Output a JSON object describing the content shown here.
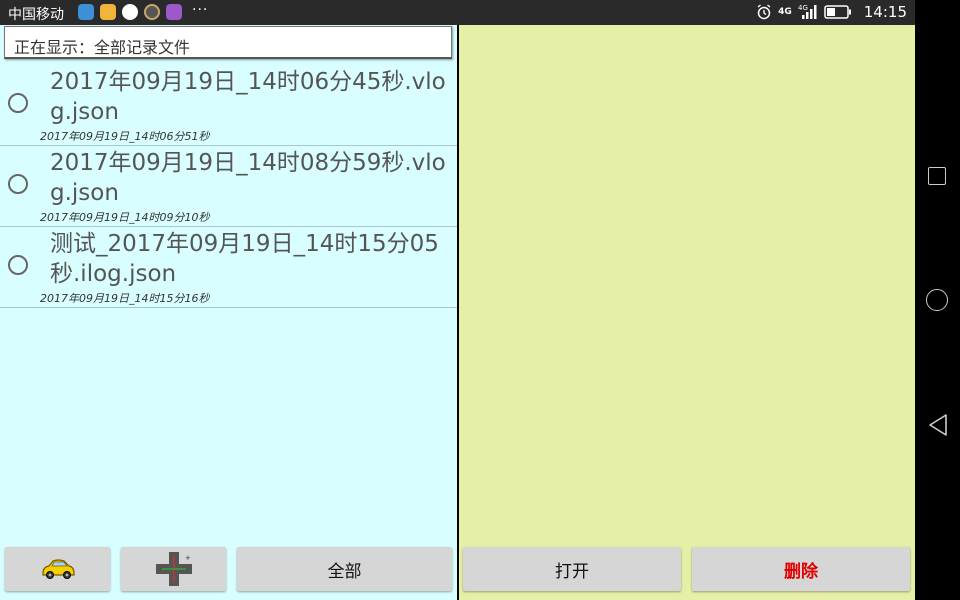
{
  "status_bar": {
    "carrier": "中国移动",
    "more": "···",
    "network": "4G",
    "time": "14:15",
    "app_icons": [
      "weibo-like-icon",
      "weibo-icon",
      "qq-icon",
      "camera-icon",
      "gallery-icon"
    ]
  },
  "header": {
    "label": "正在显示：全部记录文件"
  },
  "files": [
    {
      "name": "2017年09月19日_14时06分45秒.vlog.json",
      "time": "2017年09月19日_14时06分51秒"
    },
    {
      "name": "2017年09月19日_14时08分59秒.vlog.json",
      "time": "2017年09月19日_14时09分10秒"
    },
    {
      "name": "测试_2017年09月19日_14时15分05秒.ilog.json",
      "time": "2017年09月19日_14时15分16秒"
    }
  ],
  "buttons": {
    "all": "全部",
    "open": "打开",
    "delete": "删除"
  },
  "colors": {
    "left_bg": "#d9feff",
    "right_bg": "#e5efa6",
    "delete_text": "#e00000"
  }
}
